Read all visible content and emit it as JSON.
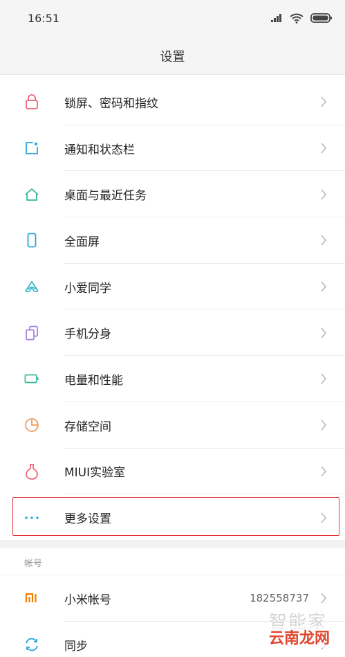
{
  "status_bar": {
    "time": "16:51"
  },
  "header": {
    "title": "设置"
  },
  "settings": [
    {
      "label": "锁屏、密码和指纹",
      "icon": "lock-icon",
      "color": "#f0607a"
    },
    {
      "label": "通知和状态栏",
      "icon": "notification-icon",
      "color": "#2aa6d8"
    },
    {
      "label": "桌面与最近任务",
      "icon": "home-icon",
      "color": "#34b89a"
    },
    {
      "label": "全面屏",
      "icon": "phone-icon",
      "color": "#2aa6d8"
    },
    {
      "label": "小爱同学",
      "icon": "xiaoai-icon",
      "color": "#2fb3c8"
    },
    {
      "label": "手机分身",
      "icon": "dual-phone-icon",
      "color": "#a07ee0"
    },
    {
      "label": "电量和性能",
      "icon": "battery-icon",
      "color": "#34b89a"
    },
    {
      "label": "存储空间",
      "icon": "pie-chart-icon",
      "color": "#f39a5c"
    },
    {
      "label": "MIUI实验室",
      "icon": "flask-icon",
      "color": "#f0607a"
    },
    {
      "label": "更多设置",
      "icon": "more-dots-icon",
      "color": "#2aa6d8"
    }
  ],
  "account_section": {
    "header": "帐号",
    "items": [
      {
        "label": "小米帐号",
        "value": "182558737",
        "icon": "mi-logo-icon",
        "color": "#f57c00"
      },
      {
        "label": "同步",
        "icon": "sync-icon",
        "color": "#2aa6d8"
      }
    ]
  },
  "watermark": {
    "top": "智能家",
    "bottom": "云南龙网"
  }
}
